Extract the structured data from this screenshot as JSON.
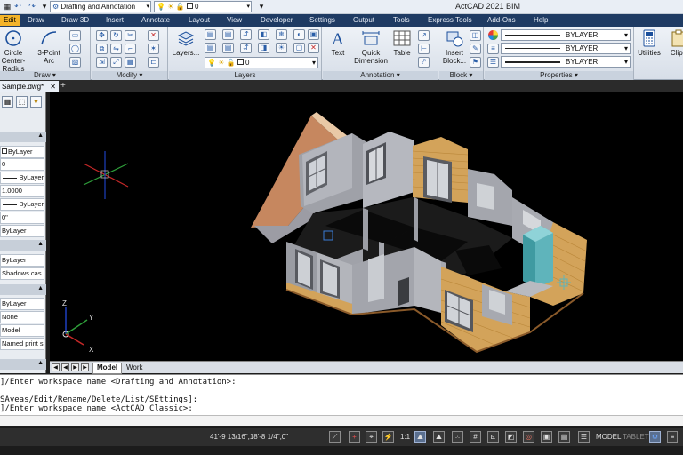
{
  "title_bar": {
    "app_title": "ActCAD 2021 BIM",
    "workspace_combo": "Drafting and Annotation",
    "layer_combo": "0"
  },
  "menu_tabs": [
    "Edit",
    "Draw",
    "Draw 3D",
    "Insert",
    "Annotate",
    "Layout",
    "View",
    "Developer",
    "Settings",
    "Output",
    "Tools",
    "Express Tools",
    "Add-Ons",
    "Help"
  ],
  "ribbon": {
    "draw": {
      "label": "Draw",
      "circle": "Circle\nCenter-Radius",
      "arc": "3-Point\nArc"
    },
    "modify": {
      "label": "Modify"
    },
    "layers": {
      "label": "Layers",
      "layers_btn": "Layers...",
      "layer_value": "0"
    },
    "annotation": {
      "label": "Annotation",
      "text": "Text",
      "quick_dimension": "Quick\nDimension",
      "table": "Table"
    },
    "block": {
      "label": "Block",
      "insert_block": "Insert\nBlock..."
    },
    "properties": {
      "label": "Properties",
      "color": "BYLAYER",
      "linetype": "BYLAYER",
      "lineweight": "BYLAYER"
    },
    "utilities": {
      "label": "Utilities"
    },
    "clipboard": {
      "label": "Clipb"
    }
  },
  "doc_tab": {
    "name": "Sample.dwg*",
    "add": "+"
  },
  "palette": {
    "rows": [
      "ByLayer",
      "0",
      "ByLayer",
      "1.0000",
      "ByLayer",
      "0\"",
      "ByLayer",
      "ByLayer",
      "Shadows cas...",
      "ByLayer",
      "None",
      "Model",
      "Named print s..."
    ]
  },
  "layout_tabs": {
    "model": "Model",
    "work": "Work"
  },
  "ucs": {
    "x": "X",
    "y": "Y",
    "z": "Z"
  },
  "command": {
    "lines": [
      "]/Enter workspace name <Drafting and Annotation>:",
      "SAveas/Edit/Rename/Delete/List/SEttings]:",
      "]/Enter workspace name <ActCAD Classic>:"
    ]
  },
  "status": {
    "coords": "41'-9 13/16\",18'-8 1/4\",0\"",
    "scale": "1:1",
    "model": "MODEL",
    "tablet": "TABLET"
  },
  "colors": {
    "menu_bg": "#1f3b63",
    "active_tab": "#f4b42a",
    "viewport_bg": "#000000",
    "wall_gray": "#a7a9b0",
    "siding_tan": "#d3a35a"
  }
}
